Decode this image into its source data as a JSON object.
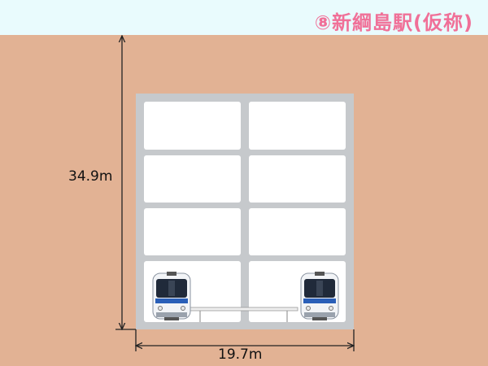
{
  "title": "⑧新綱島駅(仮称)",
  "dimensions": {
    "height": "34.9m",
    "width": "19.7m"
  },
  "colors": {
    "ground": "#e2b294",
    "sky": "#e9fbfd",
    "concrete": "#c6c9cc",
    "title": "#f07098"
  },
  "structure": {
    "floors": 4,
    "bays": 2,
    "tracks": 2
  },
  "icons": [
    "train-icon-left",
    "train-icon-right",
    "platform-icon"
  ]
}
